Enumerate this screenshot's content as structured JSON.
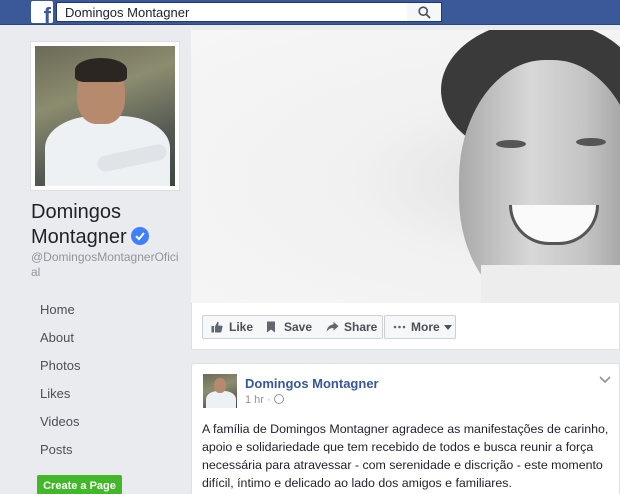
{
  "search": {
    "value": "Domingos Montagner"
  },
  "page": {
    "name": "Domingos Montagner",
    "handle": "@DomingosMontagnerOficial"
  },
  "nav": {
    "items": [
      "Home",
      "About",
      "Photos",
      "Likes",
      "Videos",
      "Posts"
    ],
    "create_page": "Create a Page"
  },
  "actions": {
    "like": "Like",
    "save": "Save",
    "share": "Share",
    "more": "More"
  },
  "post": {
    "author": "Domingos Montagner",
    "time": "1 hr ·",
    "text": "A família de Domingos Montagner agradece as manifestações de carinho, apoio e solidariedade que tem recebido de todos e busca reunir a força necessária para atravessar - com serenidade e discrição - este momento difícil, íntimo e delicado ao lado dos amigos e familiares."
  },
  "colors": {
    "topbar": "#3b5998",
    "link": "#365899",
    "verified": "#4080ff",
    "create_button": "#42b72a"
  },
  "icons": [
    "facebook-logo-icon",
    "search-icon",
    "verified-badge-icon",
    "like-thumb-icon",
    "save-bookmark-icon",
    "share-arrow-icon",
    "more-dots-icon",
    "globe-icon",
    "chevron-down-icon"
  ]
}
